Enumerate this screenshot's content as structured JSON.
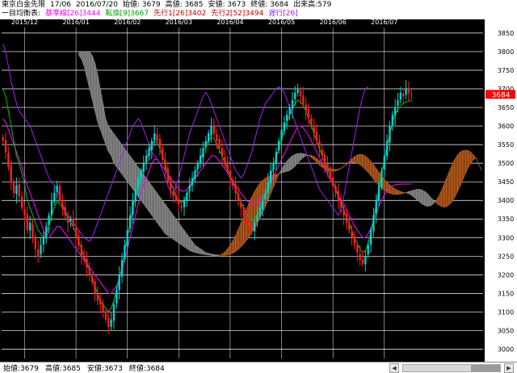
{
  "header": {
    "line1": {
      "instrument": "東京白金先限",
      "contract": "17/06",
      "date": "2016/07/20",
      "open": "始値: 3679",
      "high": "高値: 3685",
      "low": "安値: 3673",
      "close": "終値: 3684",
      "volume": "出来高:579"
    },
    "line2": {
      "title": "一目均衡表:",
      "kijun": "基準線[26]3444",
      "tenkan": "転換[9]3667",
      "senkou1": "先行1[26]3402",
      "senkou2": "先行2[52]3494",
      "chikou": "遅行[26]"
    }
  },
  "footer": {
    "open": "始値:3679",
    "high": "高値:3685",
    "low": "安値:3673",
    "close": "終値:3684"
  },
  "colors": {
    "background": "#000000",
    "grid": "#ffffff",
    "up_candle": "#00d4d4",
    "down_candle": "#ff2020",
    "tenkan": "#00c000",
    "kijun": "#ff00ff",
    "chikou": "#a020f0",
    "cloud_bull": "#8b4513",
    "cloud_bear": "#707070",
    "last_price_badge": "#ff0000"
  },
  "chart_data": {
    "type": "candlestick",
    "x_labels": [
      "2015/12",
      "2016/01",
      "2016/02",
      "2016/03",
      "2016/04",
      "2016/05",
      "2016/06",
      "2016/07"
    ],
    "y_ticks": [
      3000,
      3050,
      3100,
      3150,
      3200,
      3250,
      3300,
      3350,
      3400,
      3450,
      3500,
      3550,
      3600,
      3650,
      3700,
      3750,
      3800,
      3850
    ],
    "ylim": [
      2975,
      3865
    ],
    "last_price": "3684",
    "grid": true,
    "legend_placement": "top-left",
    "close_series": [
      3560,
      3530,
      3490,
      3450,
      3420,
      3440,
      3410,
      3380,
      3360,
      3320,
      3340,
      3300,
      3270,
      3250,
      3280,
      3300,
      3330,
      3360,
      3400,
      3420,
      3440,
      3400,
      3380,
      3360,
      3340,
      3350,
      3330,
      3300,
      3280,
      3250,
      3240,
      3220,
      3200,
      3180,
      3150,
      3130,
      3120,
      3100,
      3080,
      3060,
      3080,
      3120,
      3160,
      3200,
      3240,
      3280,
      3320,
      3360,
      3400,
      3430,
      3460,
      3480,
      3500,
      3520,
      3540,
      3560,
      3580,
      3560,
      3540,
      3510,
      3480,
      3450,
      3430,
      3410,
      3400,
      3390,
      3380,
      3400,
      3420,
      3440,
      3460,
      3480,
      3500,
      3520,
      3540,
      3560,
      3580,
      3600,
      3580,
      3560,
      3540,
      3520,
      3500,
      3480,
      3460,
      3440,
      3420,
      3400,
      3380,
      3360,
      3340,
      3330,
      3320,
      3340,
      3360,
      3380,
      3400,
      3420,
      3450,
      3480,
      3500,
      3530,
      3560,
      3590,
      3610,
      3630,
      3650,
      3670,
      3690,
      3700,
      3680,
      3660,
      3640,
      3620,
      3600,
      3580,
      3560,
      3540,
      3520,
      3500,
      3480,
      3460,
      3440,
      3420,
      3400,
      3380,
      3360,
      3340,
      3320,
      3300,
      3280,
      3260,
      3240,
      3230,
      3250,
      3280,
      3320,
      3360,
      3400,
      3440,
      3480,
      3520,
      3560,
      3600,
      3630,
      3650,
      3670,
      3690,
      3680,
      3700,
      3690,
      3684
    ],
    "tenkan_series": [
      3700,
      3680,
      3640,
      3600,
      3560,
      3520,
      3500,
      3470,
      3440,
      3400,
      3380,
      3360,
      3340,
      3320,
      3310,
      3300,
      3310,
      3330,
      3360,
      3380,
      3400,
      3390,
      3380,
      3370,
      3350,
      3340,
      3330,
      3310,
      3290,
      3270,
      3250,
      3230,
      3210,
      3190,
      3170,
      3150,
      3130,
      3120,
      3110,
      3100,
      3110,
      3130,
      3160,
      3190,
      3220,
      3260,
      3300,
      3340,
      3380,
      3410,
      3440,
      3470,
      3490,
      3510,
      3530,
      3550,
      3560,
      3555,
      3540,
      3520,
      3500,
      3470,
      3450,
      3430,
      3410,
      3400,
      3395,
      3400,
      3410,
      3430,
      3450,
      3470,
      3490,
      3510,
      3530,
      3550,
      3560,
      3570,
      3565,
      3550,
      3535,
      3520,
      3500,
      3485,
      3465,
      3450,
      3430,
      3410,
      3395,
      3380,
      3365,
      3355,
      3345,
      3350,
      3360,
      3375,
      3395,
      3415,
      3440,
      3465,
      3490,
      3515,
      3540,
      3565,
      3590,
      3610,
      3630,
      3645,
      3660,
      3670,
      3665,
      3655,
      3640,
      3620,
      3600,
      3580,
      3560,
      3540,
      3520,
      3500,
      3485,
      3465,
      3450,
      3430,
      3410,
      3395,
      3375,
      3355,
      3340,
      3320,
      3300,
      3285,
      3270,
      3260,
      3265,
      3285,
      3315,
      3350,
      3390,
      3430,
      3470,
      3510,
      3545,
      3580,
      3610,
      3630,
      3645,
      3655,
      3660,
      3665,
      3667,
      3667
    ],
    "kijun_series": [
      3620,
      3610,
      3590,
      3570,
      3550,
      3530,
      3510,
      3490,
      3460,
      3440,
      3420,
      3400,
      3380,
      3360,
      3340,
      3320,
      3300,
      3300,
      3310,
      3320,
      3330,
      3330,
      3320,
      3310,
      3300,
      3290,
      3280,
      3270,
      3260,
      3250,
      3240,
      3230,
      3220,
      3210,
      3200,
      3190,
      3180,
      3170,
      3160,
      3150,
      3150,
      3160,
      3170,
      3190,
      3210,
      3240,
      3270,
      3300,
      3330,
      3360,
      3390,
      3420,
      3440,
      3460,
      3480,
      3500,
      3510,
      3510,
      3500,
      3490,
      3480,
      3470,
      3460,
      3450,
      3440,
      3430,
      3425,
      3425,
      3430,
      3440,
      3450,
      3460,
      3470,
      3480,
      3490,
      3500,
      3510,
      3520,
      3520,
      3515,
      3505,
      3495,
      3485,
      3475,
      3460,
      3450,
      3440,
      3430,
      3420,
      3410,
      3400,
      3395,
      3390,
      3390,
      3395,
      3400,
      3410,
      3420,
      3435,
      3450,
      3465,
      3480,
      3495,
      3510,
      3525,
      3540,
      3555,
      3570,
      3585,
      3600,
      3600,
      3595,
      3585,
      3575,
      3560,
      3545,
      3530,
      3515,
      3500,
      3485,
      3470,
      3455,
      3445,
      3430,
      3415,
      3400,
      3390,
      3375,
      3360,
      3345,
      3330,
      3320,
      3310,
      3300,
      3300,
      3310,
      3325,
      3345,
      3365,
      3385,
      3400,
      3415,
      3425,
      3435,
      3440,
      3442,
      3443,
      3444,
      3444,
      3444,
      3444,
      3444
    ],
    "chikou_series": [
      3820,
      3800,
      3760,
      3720,
      3690,
      3660,
      3640,
      3630,
      3620,
      3610,
      3600,
      3580,
      3560,
      3540,
      3520,
      3500,
      3480,
      3460,
      3450,
      3440,
      3430,
      3410,
      3390,
      3370,
      3360,
      3350,
      3340,
      3330,
      3320,
      3310,
      3300,
      3295,
      3290,
      3300,
      3320,
      3340,
      3360,
      3380,
      3400,
      3420,
      3440,
      3460,
      3480,
      3500,
      3520,
      3540,
      3560,
      3580,
      3600,
      3610,
      3620,
      3610,
      3590,
      3570,
      3550,
      3530,
      3520,
      3510,
      3500,
      3480,
      3460,
      3440,
      3420,
      3420,
      3440,
      3460,
      3490,
      3520,
      3550,
      3580,
      3600,
      3620,
      3640,
      3660,
      3680,
      3690,
      3680,
      3660,
      3640,
      3620,
      3600,
      3580,
      3560,
      3540,
      3520,
      3500,
      3480,
      3470,
      3460,
      3470,
      3490,
      3510,
      3530,
      3560,
      3590,
      3620,
      3640,
      3660,
      3670,
      3680,
      3690,
      3700,
      3705,
      3700,
      3690,
      3670,
      3650,
      3630,
      3610,
      3590,
      3570,
      3550,
      3530,
      3510,
      3490,
      3470,
      3450,
      3430,
      3420,
      3410,
      3400,
      3390,
      3380,
      3370,
      3360,
      3380,
      3410,
      3450,
      3490,
      3530,
      3570,
      3610,
      3650,
      3680,
      3700,
      3705
    ],
    "senkou1_series": [
      3790,
      3780,
      3760,
      3730,
      3700,
      3670,
      3640,
      3610,
      3590,
      3570,
      3550,
      3530,
      3520,
      3500,
      3490,
      3480,
      3470,
      3460,
      3450,
      3440,
      3430,
      3420,
      3410,
      3400,
      3390,
      3380,
      3370,
      3360,
      3350,
      3340,
      3330,
      3320,
      3310,
      3305,
      3300,
      3295,
      3290,
      3285,
      3280,
      3275,
      3270,
      3265,
      3262,
      3260,
      3258,
      3256,
      3255,
      3254,
      3253,
      3252,
      3251,
      3250,
      3252,
      3256,
      3262,
      3270,
      3280,
      3292,
      3306,
      3322,
      3340,
      3358,
      3376,
      3394,
      3410,
      3424,
      3436,
      3446,
      3454,
      3460,
      3464,
      3466,
      3468,
      3470,
      3472,
      3474,
      3476,
      3478,
      3480,
      3485,
      3492,
      3500,
      3508,
      3515,
      3520,
      3522,
      3521,
      3518,
      3513,
      3507,
      3500,
      3494,
      3489,
      3486,
      3484,
      3483,
      3484,
      3487,
      3492,
      3498,
      3505,
      3512,
      3518,
      3522,
      3524,
      3523,
      3519,
      3513,
      3505,
      3496,
      3486,
      3476,
      3466,
      3457,
      3449,
      3442,
      3436,
      3431,
      3427,
      3424,
      3422,
      3420,
      3418,
      3414,
      3408,
      3402,
      3396,
      3390,
      3386,
      3384,
      3385,
      3390,
      3398,
      3410,
      3425,
      3442,
      3460,
      3478,
      3495,
      3510,
      3522,
      3530,
      3534,
      3535,
      3534,
      3530,
      3522,
      3510,
      3496,
      3480
    ],
    "senkou2_series": [
      3800,
      3800,
      3800,
      3800,
      3800,
      3790,
      3770,
      3740,
      3700,
      3660,
      3620,
      3600,
      3590,
      3580,
      3570,
      3560,
      3550,
      3540,
      3530,
      3520,
      3510,
      3500,
      3490,
      3480,
      3470,
      3460,
      3450,
      3440,
      3430,
      3420,
      3410,
      3400,
      3390,
      3380,
      3370,
      3360,
      3350,
      3340,
      3330,
      3320,
      3310,
      3300,
      3290,
      3280,
      3275,
      3270,
      3265,
      3260,
      3258,
      3256,
      3255,
      3254,
      3253,
      3252,
      3252,
      3253,
      3255,
      3258,
      3262,
      3268,
      3275,
      3283,
      3292,
      3302,
      3313,
      3325,
      3338,
      3352,
      3367,
      3383,
      3400,
      3418,
      3436,
      3454,
      3470,
      3484,
      3496,
      3506,
      3514,
      3520,
      3524,
      3526,
      3527,
      3526,
      3524,
      3520,
      3515,
      3509,
      3502,
      3495,
      3489,
      3484,
      3480,
      3478,
      3478,
      3479,
      3482,
      3486,
      3491,
      3496,
      3500,
      3502,
      3502,
      3500,
      3496,
      3490,
      3483,
      3475,
      3466,
      3457,
      3448,
      3440,
      3433,
      3427,
      3422,
      3419,
      3417,
      3416,
      3416,
      3417,
      3419,
      3421,
      3424,
      3426,
      3428,
      3430,
      3430,
      3428,
      3424,
      3418,
      3410,
      3402,
      3394,
      3388,
      3384,
      3382,
      3383,
      3388,
      3396,
      3408,
      3422,
      3438,
      3455,
      3472,
      3488,
      3500,
      3510,
      3515
    ]
  }
}
